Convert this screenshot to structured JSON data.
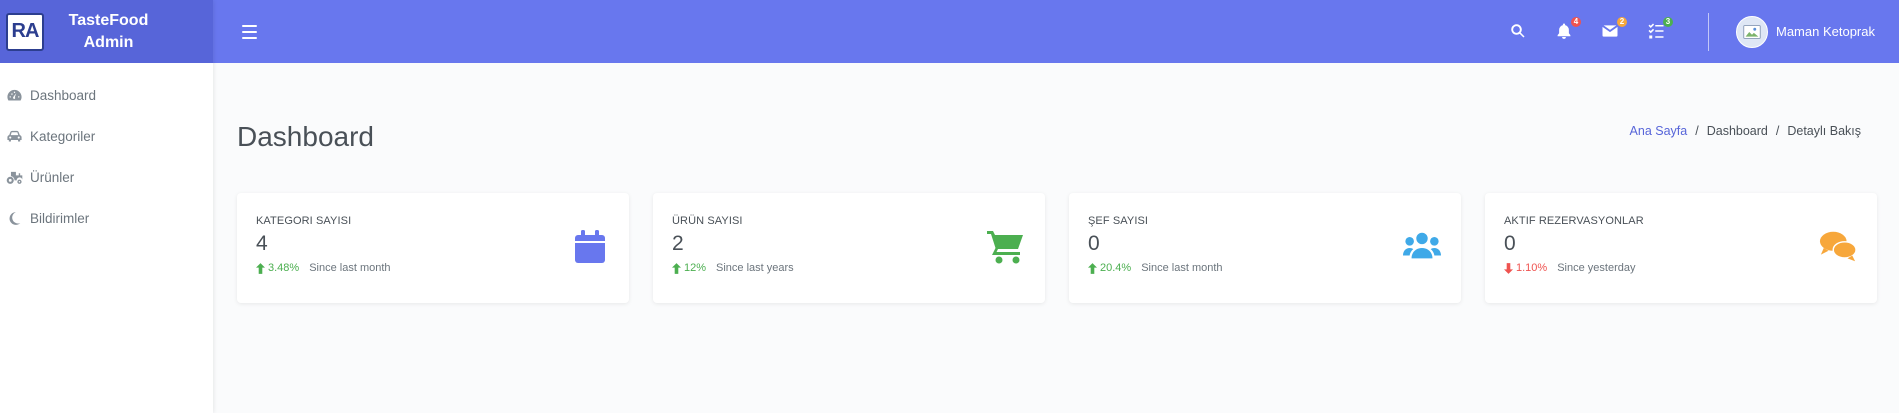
{
  "brand": {
    "logo_text": "RA",
    "title_line1": "TasteFood",
    "title_line2": "Admin"
  },
  "sidebar": {
    "items": [
      {
        "label": "Dashboard",
        "icon": "tachometer-icon"
      },
      {
        "label": "Kategoriler",
        "icon": "car-icon"
      },
      {
        "label": "Ürünler",
        "icon": "tractor-icon"
      },
      {
        "label": "Bildirimler",
        "icon": "moon-icon"
      }
    ]
  },
  "topbar": {
    "notifications_count": "4",
    "messages_count": "2",
    "tasks_count": "3",
    "user_name": "Maman Ketoprak"
  },
  "page": {
    "title": "Dashboard",
    "breadcrumb": [
      "Ana Sayfa",
      "Dashboard",
      "Detaylı Bakış"
    ]
  },
  "cards": [
    {
      "label": "KATEGORI SAYISI",
      "value": "4",
      "trend": "3.48%",
      "trend_dir": "up",
      "period": "Since last month",
      "icon": "calendar-icon",
      "color": "#6877ee"
    },
    {
      "label": "ÜRÜN SAYISI",
      "value": "2",
      "trend": "12%",
      "trend_dir": "up",
      "period": "Since last years",
      "icon": "cart-icon",
      "color": "#4caf50"
    },
    {
      "label": "ŞEF SAYISI",
      "value": "0",
      "trend": "20.4%",
      "trend_dir": "up",
      "period": "Since last month",
      "icon": "users-icon",
      "color": "#3fa9e8"
    },
    {
      "label": "AKTIF REZERVASYONLAR",
      "value": "0",
      "trend": "1.10%",
      "trend_dir": "down",
      "period": "Since yesterday",
      "icon": "comments-icon",
      "color": "#f7a73b"
    }
  ],
  "colors": {
    "topbar": "#6877ee",
    "brand": "#5765d9",
    "up": "#4caf50",
    "down": "#ef5350"
  }
}
